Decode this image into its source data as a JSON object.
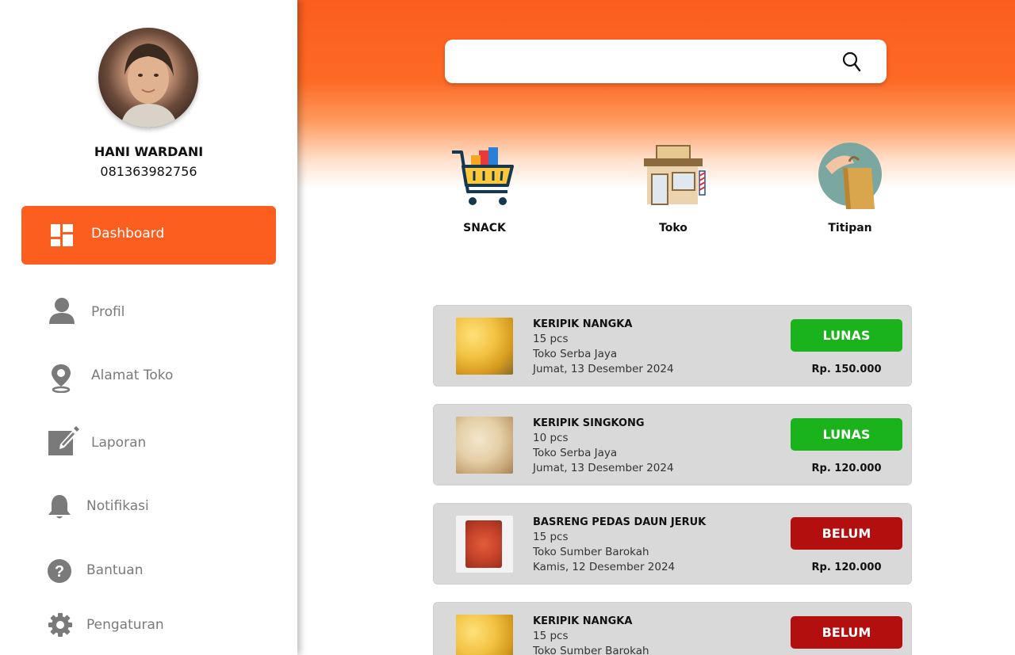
{
  "user": {
    "name": "HANI WARDANI",
    "phone": "081363982756"
  },
  "nav": {
    "dashboard": "Dashboard",
    "profil": "Profil",
    "alamat": "Alamat Toko",
    "laporan": "Laporan",
    "notifikasi": "Notifikasi",
    "bantuan": "Bantuan",
    "pengaturan": "Pengaturan"
  },
  "search": {
    "placeholder": ""
  },
  "categories": [
    {
      "label": "SNACK",
      "icon": "shopping-cart-icon"
    },
    {
      "label": "Toko",
      "icon": "store-icon"
    },
    {
      "label": "Titipan",
      "icon": "shopping-bag-icon"
    }
  ],
  "orders": [
    {
      "name": "KERIPIK NANGKA",
      "qty": "15 pcs",
      "store": "Toko Serba Jaya",
      "date": "Jumat, 13 Desember 2024",
      "status": "LUNAS",
      "price": "Rp. 150.000"
    },
    {
      "name": "KERIPIK SINGKONG",
      "qty": "10 pcs",
      "store": "Toko Serba Jaya",
      "date": "Jumat, 13 Desember 2024",
      "status": "LUNAS",
      "price": "Rp. 120.000"
    },
    {
      "name": "BASRENG PEDAS DAUN JERUK",
      "qty": "15 pcs",
      "store": "Toko Sumber Barokah",
      "date": "Kamis, 12 Desember 2024",
      "status": "BELUM",
      "price": "Rp. 120.000"
    },
    {
      "name": "KERIPIK NANGKA",
      "qty": "15 pcs",
      "store": "Toko Sumber Barokah",
      "date": "",
      "status": "BELUM",
      "price": ""
    }
  ],
  "colors": {
    "accent": "#fb5e1f",
    "paid": "#1bb31b",
    "unpaid": "#b30f0f",
    "nav_text": "#7a7a7a"
  }
}
